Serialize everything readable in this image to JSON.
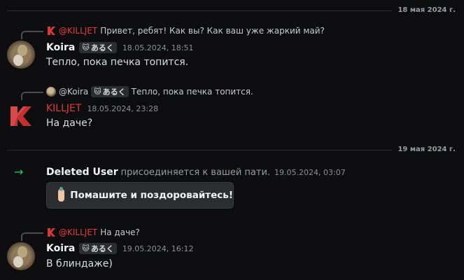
{
  "dates": [
    "18 мая 2024 г.",
    "19 мая 2024 г."
  ],
  "messages": [
    {
      "reply_to": {
        "author": "@KILLJET",
        "text": "Привет, ребят!  Как вы? Как ваш уже жаркий май?"
      },
      "author": "Koira",
      "tag": "あるく",
      "tag_icon": "🐱",
      "timestamp": "18.05.2024, 18:51",
      "text": "Тепло, пока печка топится."
    },
    {
      "reply_to": {
        "author": "@Koira",
        "tag": "あるく",
        "tag_icon": "🐱",
        "text": "Тепло, пока печка топится."
      },
      "author": "KILLJET",
      "timestamp": "18.05.2024, 23:28",
      "text": "На даче?"
    },
    {
      "reply_to": {
        "author": "@KILLJET",
        "text": "На даче?"
      },
      "author": "Koira",
      "tag": "あるく",
      "tag_icon": "🐱",
      "timestamp": "19.05.2024, 16:12",
      "text": "В блиндаже)"
    }
  ],
  "system": {
    "user": "Deleted User",
    "action": "присоединяется к вашей пати.",
    "timestamp": "19.05.2024, 03:07",
    "wave_button": "Помашите и поздоровайтесь!",
    "arrow": "→"
  },
  "colors": {
    "background": "#0e0e10",
    "killjet": "#e23b3b",
    "join_arrow": "#2dc770"
  }
}
